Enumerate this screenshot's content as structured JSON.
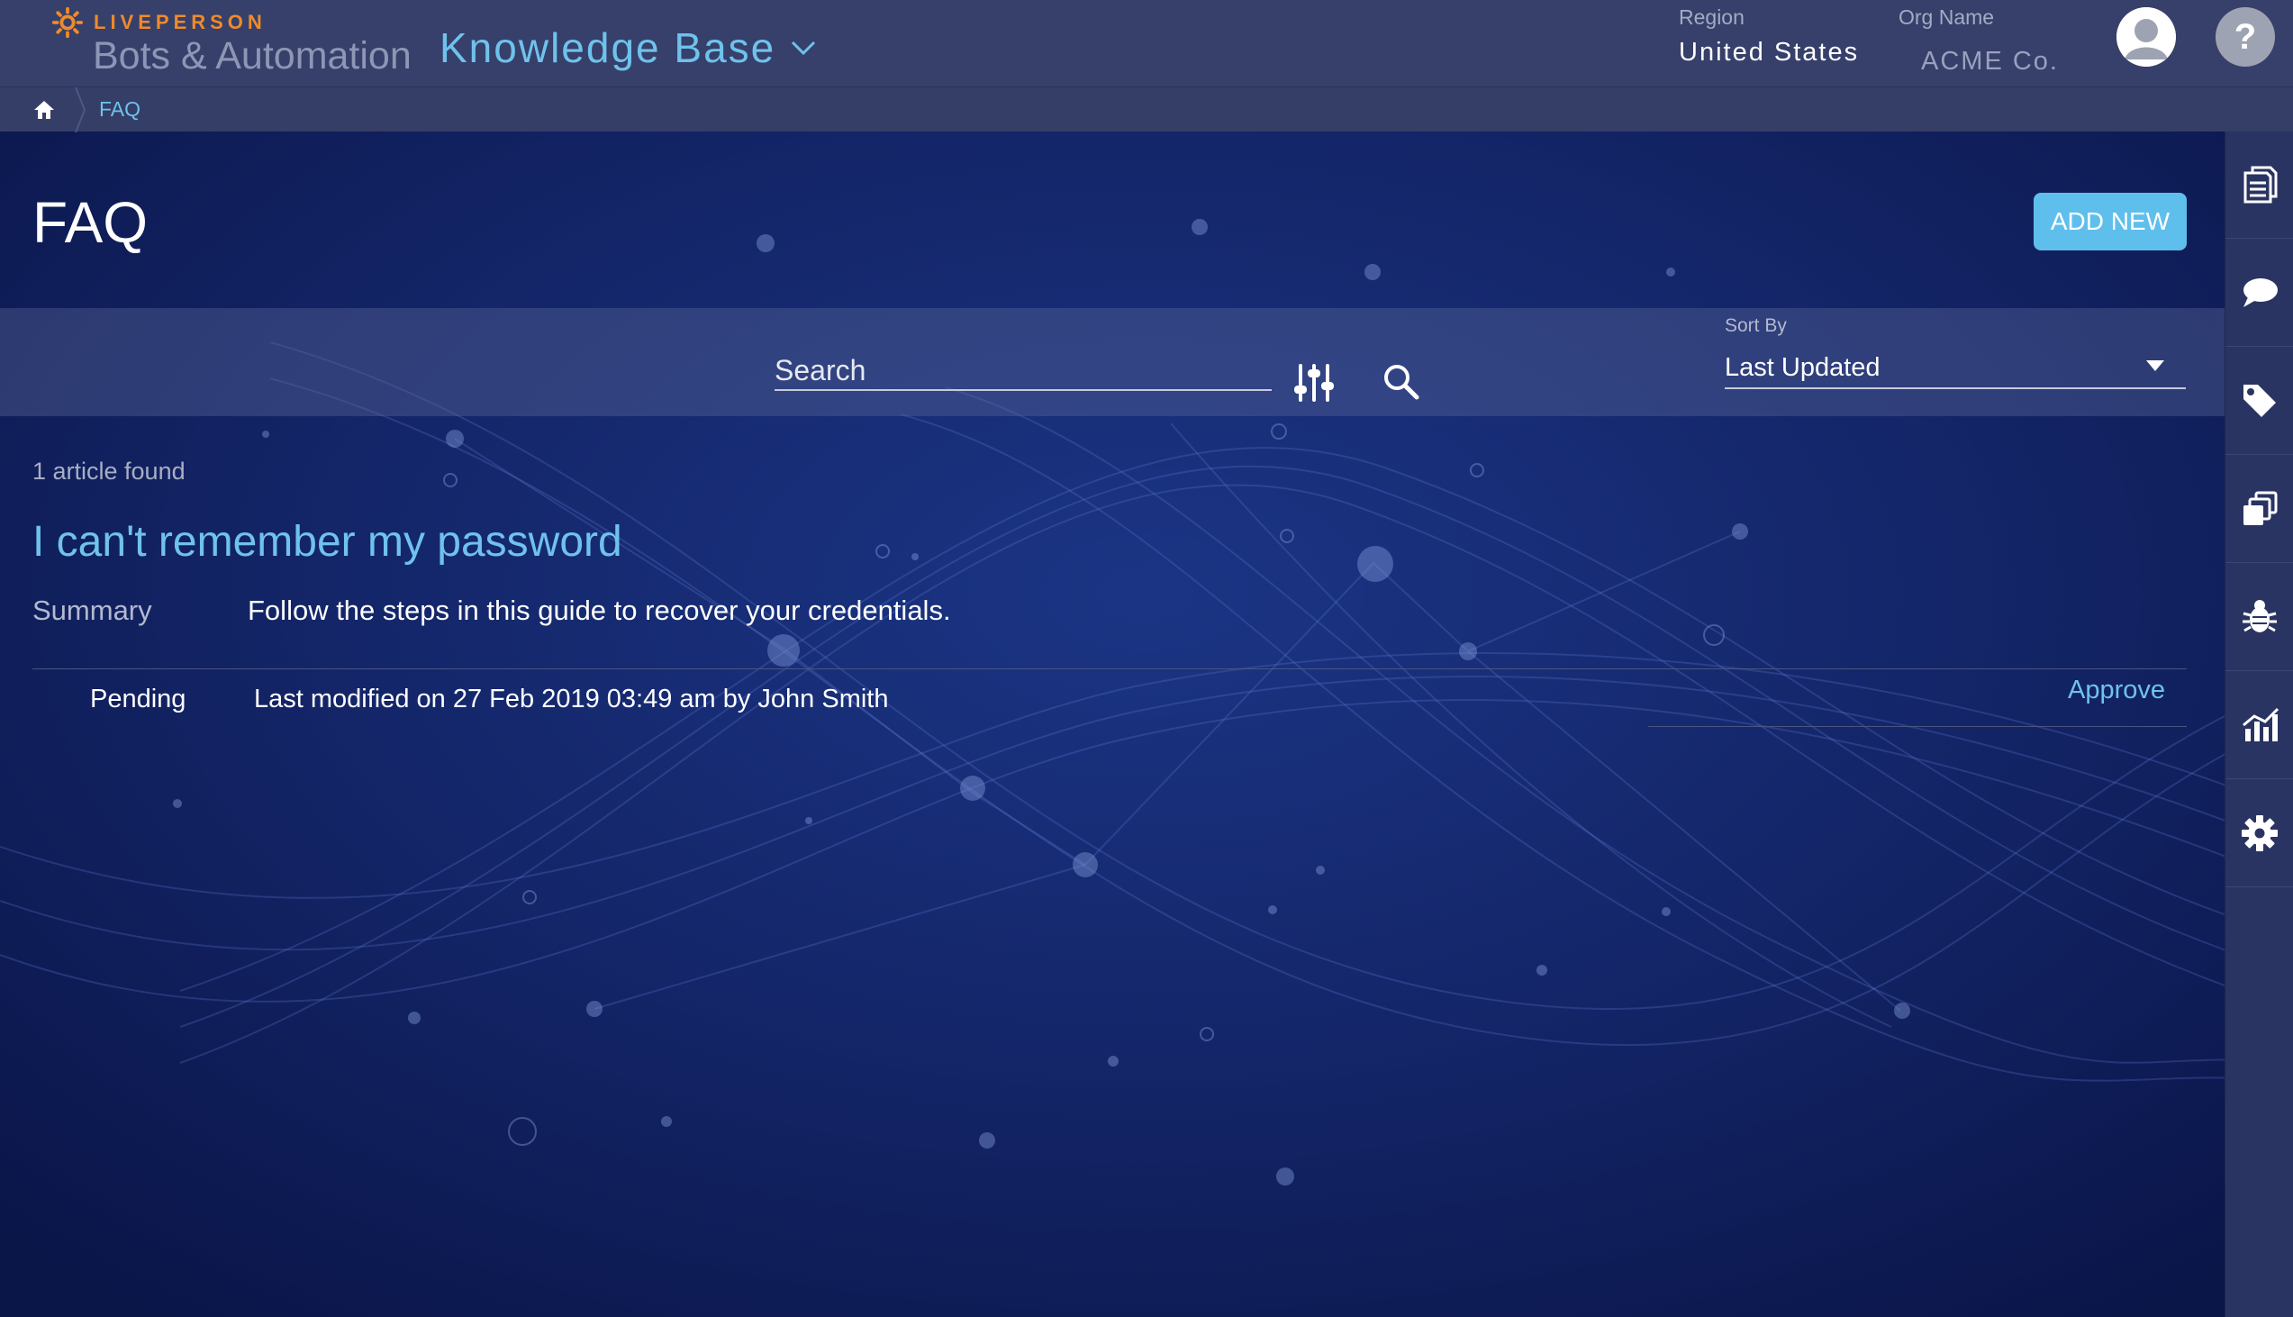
{
  "header": {
    "brand": "LIVEPERSON",
    "product": "Bots & Automation",
    "section": "Knowledge Base",
    "region_label": "Region",
    "region_value": "United States",
    "org_label": "Org Name",
    "org_value": "ACME Co.",
    "help_glyph": "?"
  },
  "breadcrumb": {
    "items": [
      "FAQ"
    ]
  },
  "page": {
    "title": "FAQ",
    "add_button": "ADD NEW"
  },
  "search": {
    "placeholder": "Search",
    "sort_label": "Sort By",
    "sort_value": "Last Updated"
  },
  "results": {
    "count_text": "1 article found",
    "articles": [
      {
        "title": "I can't remember my password",
        "summary_label": "Summary",
        "summary": "Follow the steps in this guide to recover your credentials.",
        "status": "Pending",
        "modified": "Last modified on 27 Feb 2019 03:49 am by John Smith",
        "action": "Approve"
      }
    ]
  },
  "rail": {
    "items": [
      "articles-icon",
      "chat-icon",
      "tag-icon",
      "stack-icon",
      "bug-icon",
      "analytics-icon",
      "gear-icon"
    ]
  },
  "colors": {
    "accent": "#6fc2ec",
    "brand_orange": "#f08a2a",
    "background": "#0c1a55",
    "header": "#36406a"
  }
}
